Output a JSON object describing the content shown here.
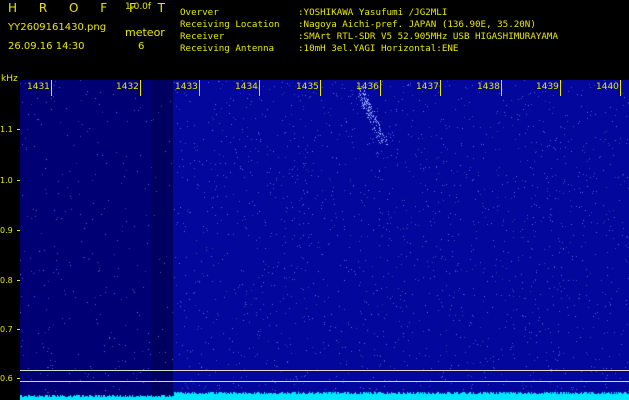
{
  "header": {
    "logo": "H R O F F T",
    "version": "1.0.0f",
    "filename": "YY2609161430.png",
    "meteor_label": "meteor",
    "meteor_count": "6",
    "datetime": "26.09.16 14:30"
  },
  "info": {
    "observer_label": "Overver",
    "observer_value": ":YOSHIKAWA Yasufumi /JG2MLI",
    "location_label": "Receiving Location",
    "location_value": ":Nagoya Aichi-pref. JAPAN (136.90E, 35.20N)",
    "receiver_label": "Receiver",
    "receiver_value": ":SMArt RTL-SDR V5 52.905MHz USB HIGASHIMURAYAMA",
    "antenna_label": "Receiving Antenna",
    "antenna_value": ":10mH 3el.YAGI Horizontal:ENE"
  },
  "axes": {
    "y_unit": "kHz",
    "y_ticks": [
      "1.1",
      "1.0",
      "0.9",
      "0.8",
      "0.7",
      "0.6"
    ],
    "x_ticks": [
      "1431",
      "1432",
      "1433",
      "1434",
      "1435",
      "1436",
      "1437",
      "1438",
      "1439",
      "1440"
    ]
  },
  "colors": {
    "text": "#e8e800",
    "background": "#000000",
    "spectrum_dark": "#000074",
    "spectrum_active": "#03079c",
    "trace": "#00e8ff"
  }
}
